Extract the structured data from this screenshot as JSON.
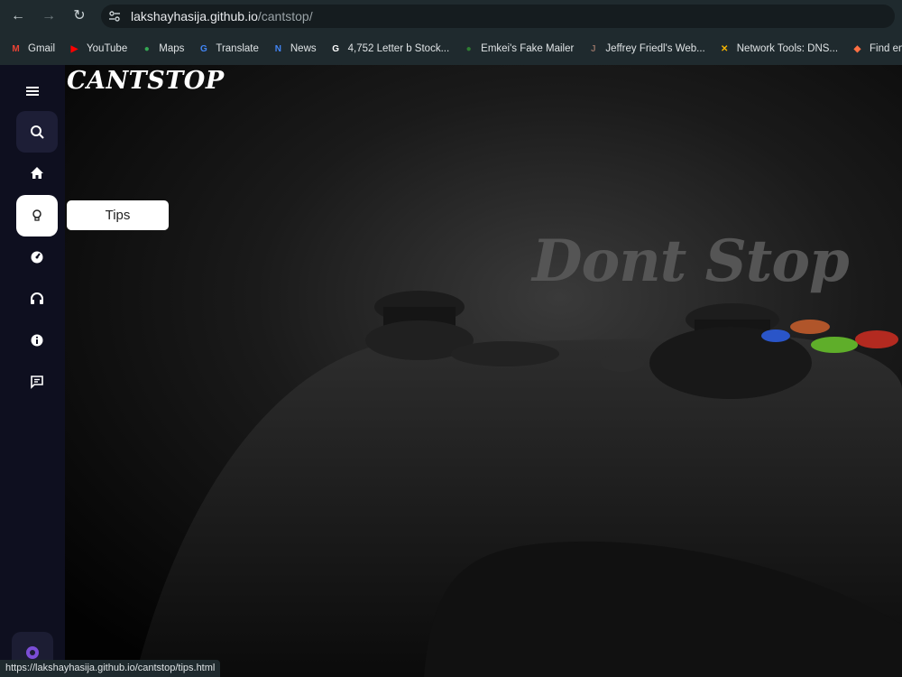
{
  "browser": {
    "url_host": "lakshayhasija.github.io",
    "url_path": "/cantstop/",
    "bookmarks": [
      {
        "label": "Gmail",
        "icon": "gmail-icon",
        "color": "#ea4335",
        "glyph": "M"
      },
      {
        "label": "YouTube",
        "icon": "youtube-icon",
        "color": "#ff0000",
        "glyph": "▶"
      },
      {
        "label": "Maps",
        "icon": "maps-icon",
        "color": "#34a853",
        "glyph": "●"
      },
      {
        "label": "Translate",
        "icon": "translate-icon",
        "color": "#4285f4",
        "glyph": "G"
      },
      {
        "label": "News",
        "icon": "news-icon",
        "color": "#4285f4",
        "glyph": "N"
      },
      {
        "label": "4,752 Letter b Stock...",
        "icon": "google-icon",
        "color": "#ffffff",
        "glyph": "G"
      },
      {
        "label": "Emkei's Fake Mailer",
        "icon": "mailer-icon",
        "color": "#2e7d32",
        "glyph": "●"
      },
      {
        "label": "Jeffrey Friedl's Web...",
        "icon": "avatar-icon",
        "color": "#8d6e63",
        "glyph": "J"
      },
      {
        "label": "Network Tools: DNS...",
        "icon": "network-tools-icon",
        "color": "#f5b400",
        "glyph": "✕"
      },
      {
        "label": "Find email add",
        "icon": "find-email-icon",
        "color": "#ff7043",
        "glyph": "◆"
      }
    ],
    "status_url": "https://lakshayhasija.github.io/cantstop/tips.html"
  },
  "app": {
    "brand": "CANTSTOP",
    "tooltip": "Tips",
    "hero_text": "Dont Stop",
    "sidebar": [
      {
        "name": "menu-icon",
        "active": false
      },
      {
        "name": "search-icon",
        "active": false
      },
      {
        "name": "home-icon",
        "active": false
      },
      {
        "name": "bulb-icon",
        "active": true
      },
      {
        "name": "gauge-icon",
        "active": false
      },
      {
        "name": "headphones-icon",
        "active": false
      },
      {
        "name": "info-icon",
        "active": false
      },
      {
        "name": "chat-icon",
        "active": false
      }
    ]
  }
}
